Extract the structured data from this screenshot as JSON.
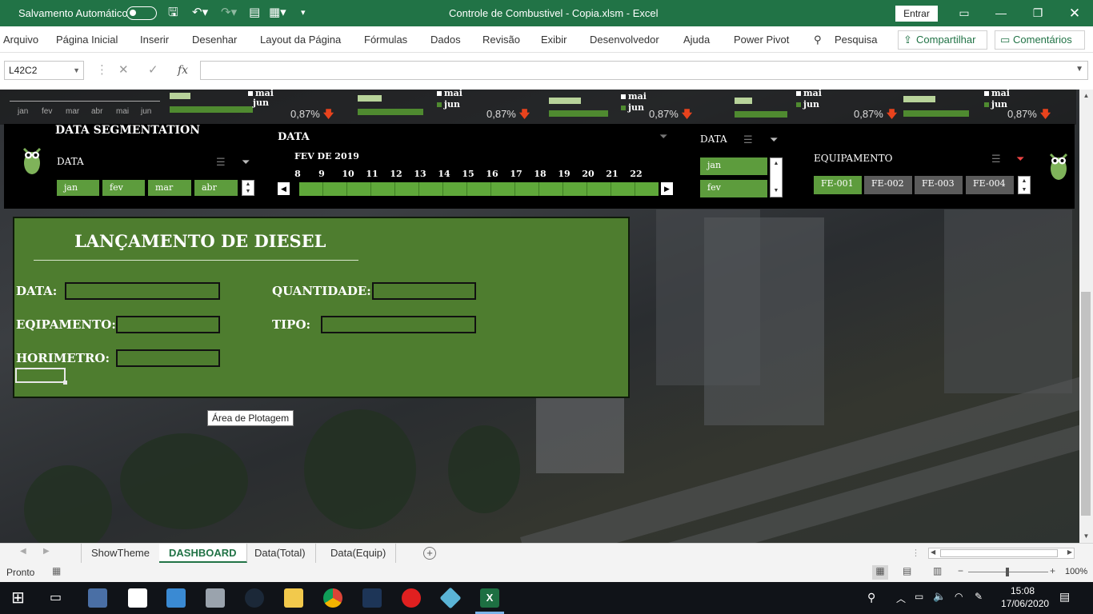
{
  "titlebar": {
    "autosave_label": "Salvamento Automático",
    "file_title": "Controle de Combustivel - Copia.xlsm  -  Excel",
    "signin": "Entrar",
    "brand_color": "#217346"
  },
  "menu": {
    "items": [
      "Arquivo",
      "Página Inicial",
      "Inserir",
      "Desenhar",
      "Layout da Página",
      "Fórmulas",
      "Dados",
      "Revisão",
      "Exibir",
      "Desenvolvedor",
      "Ajuda",
      "Power Pivot"
    ],
    "search": "Pesquisa",
    "share": "Compartilhar",
    "comments": "Comentários"
  },
  "formula_bar": {
    "name_box": "L42C2",
    "formula": ""
  },
  "kpi_strip": {
    "mini_months": [
      "jan",
      "fev",
      "mar",
      "abr",
      "mai",
      "jun"
    ],
    "legend": [
      "mai",
      "jun"
    ],
    "percents": [
      "0,87%",
      "0,87%",
      "0,87%",
      "0,87%",
      "0,87%",
      "0,87%"
    ],
    "down_arrow": "🡇"
  },
  "segmentation": {
    "title": "DATA SEGMENTATION",
    "data_label": "DATA",
    "months": [
      "jan",
      "fev",
      "mar",
      "abr"
    ],
    "timeline_title": "DATA",
    "timeline_period": "FEV DE 2019",
    "days": [
      "8",
      "9",
      "10",
      "11",
      "12",
      "13",
      "14",
      "15",
      "16",
      "17",
      "18",
      "19",
      "20",
      "21",
      "22"
    ],
    "data2_label": "DATA",
    "data2_items": [
      "jan",
      "fev"
    ],
    "equip_label": "EQUIPAMENTO",
    "equip_items": [
      "FE-001",
      "FE-002",
      "FE-003",
      "FE-004"
    ],
    "active_color": "#5d9c3d",
    "inactive_color": "#5b5b5b"
  },
  "form": {
    "title": "LANÇAMENTO DE DIESEL",
    "data_label": "DATA:",
    "quantidade_label": "QUANTIDADE:",
    "equipamento_label": "EQIPAMENTO:",
    "tipo_label": "TIPO:",
    "horimetro_label": "HORIMETRO:",
    "panel_color": "#4e7d2f"
  },
  "tooltip": "Área de Plotagem",
  "sheet_tabs": [
    "ShowTheme",
    "DASHBOARD",
    "Data(Total)",
    "Data(Equip)"
  ],
  "active_tab": "DASHBOARD",
  "status": {
    "ready": "Pronto",
    "zoom": "100%"
  },
  "taskbar": {
    "time": "15:08",
    "date": "17/06/2020"
  }
}
